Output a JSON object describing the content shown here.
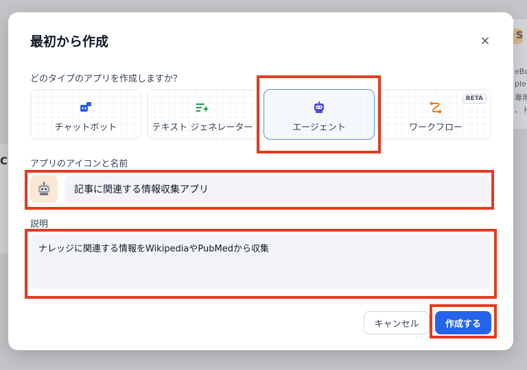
{
  "background": {
    "right_text": [
      "S",
      "eBo",
      "ple",
      "專用",
      "、ト"
    ],
    "left_text": "C"
  },
  "modal": {
    "title": "最初から作成",
    "close_label": "×",
    "question": "どのタイプのアプリを作成しますか？",
    "app_types": [
      {
        "label": "チャットボット",
        "icon": "chatbot-icon",
        "selected": false
      },
      {
        "label": "テキスト ジェネレーター",
        "icon": "text-generator-icon",
        "selected": false
      },
      {
        "label": "エージェント",
        "icon": "agent-robot-icon",
        "selected": true
      },
      {
        "label": "ワークフロー",
        "icon": "workflow-icon",
        "selected": false,
        "badge": "BETA"
      }
    ],
    "name_section_label": "アプリのアイコンと名前",
    "app_icon": "robot-emoji-icon",
    "app_name_value": "記事に関連する情報収集アプリ",
    "description_label": "説明",
    "description_value": "ナレッジに関連する情報をWikipediaやPubMedから収集",
    "cancel_label": "キャンセル",
    "create_label": "作成する"
  },
  "colors": {
    "accent": "#2563eb",
    "selected_border": "#5b8def",
    "annotation": "#e53a1e",
    "app_icon_bg": "#fbe8d4"
  }
}
